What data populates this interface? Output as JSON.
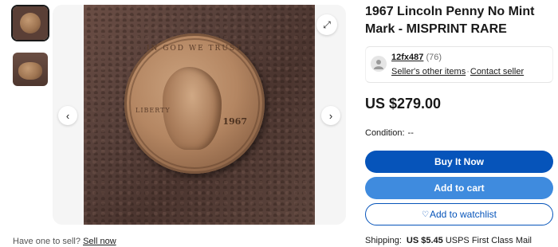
{
  "listing": {
    "title": "1967 Lincoln Penny No Mint Mark - MISPRINT RARE",
    "price": "US $279.00"
  },
  "coin_image": {
    "motto": "IN GOD WE TRUST",
    "liberty": "LIBERTY",
    "year": "1967"
  },
  "icons": {
    "prev": "‹",
    "next": "›",
    "expand": "⤢"
  },
  "seller": {
    "name": "12fx487",
    "feedback": "(76)",
    "other_items": "Seller's other items",
    "contact": "Contact seller"
  },
  "condition": {
    "label": "Condition:",
    "value": "--"
  },
  "buttons": {
    "buy_now": "Buy It Now",
    "add_to_cart": "Add to cart",
    "watchlist": "Add to watchlist",
    "watchlist_icon": "♡"
  },
  "sell": {
    "prompt": "Have one to sell?",
    "link": "Sell now"
  },
  "shipping": {
    "label": "Shipping:",
    "amount": "US $5.45",
    "service": "USPS First Class Mail"
  },
  "colors": {
    "primary": "#0654ba",
    "secondary": "#3f8bde",
    "text": "#191919"
  }
}
